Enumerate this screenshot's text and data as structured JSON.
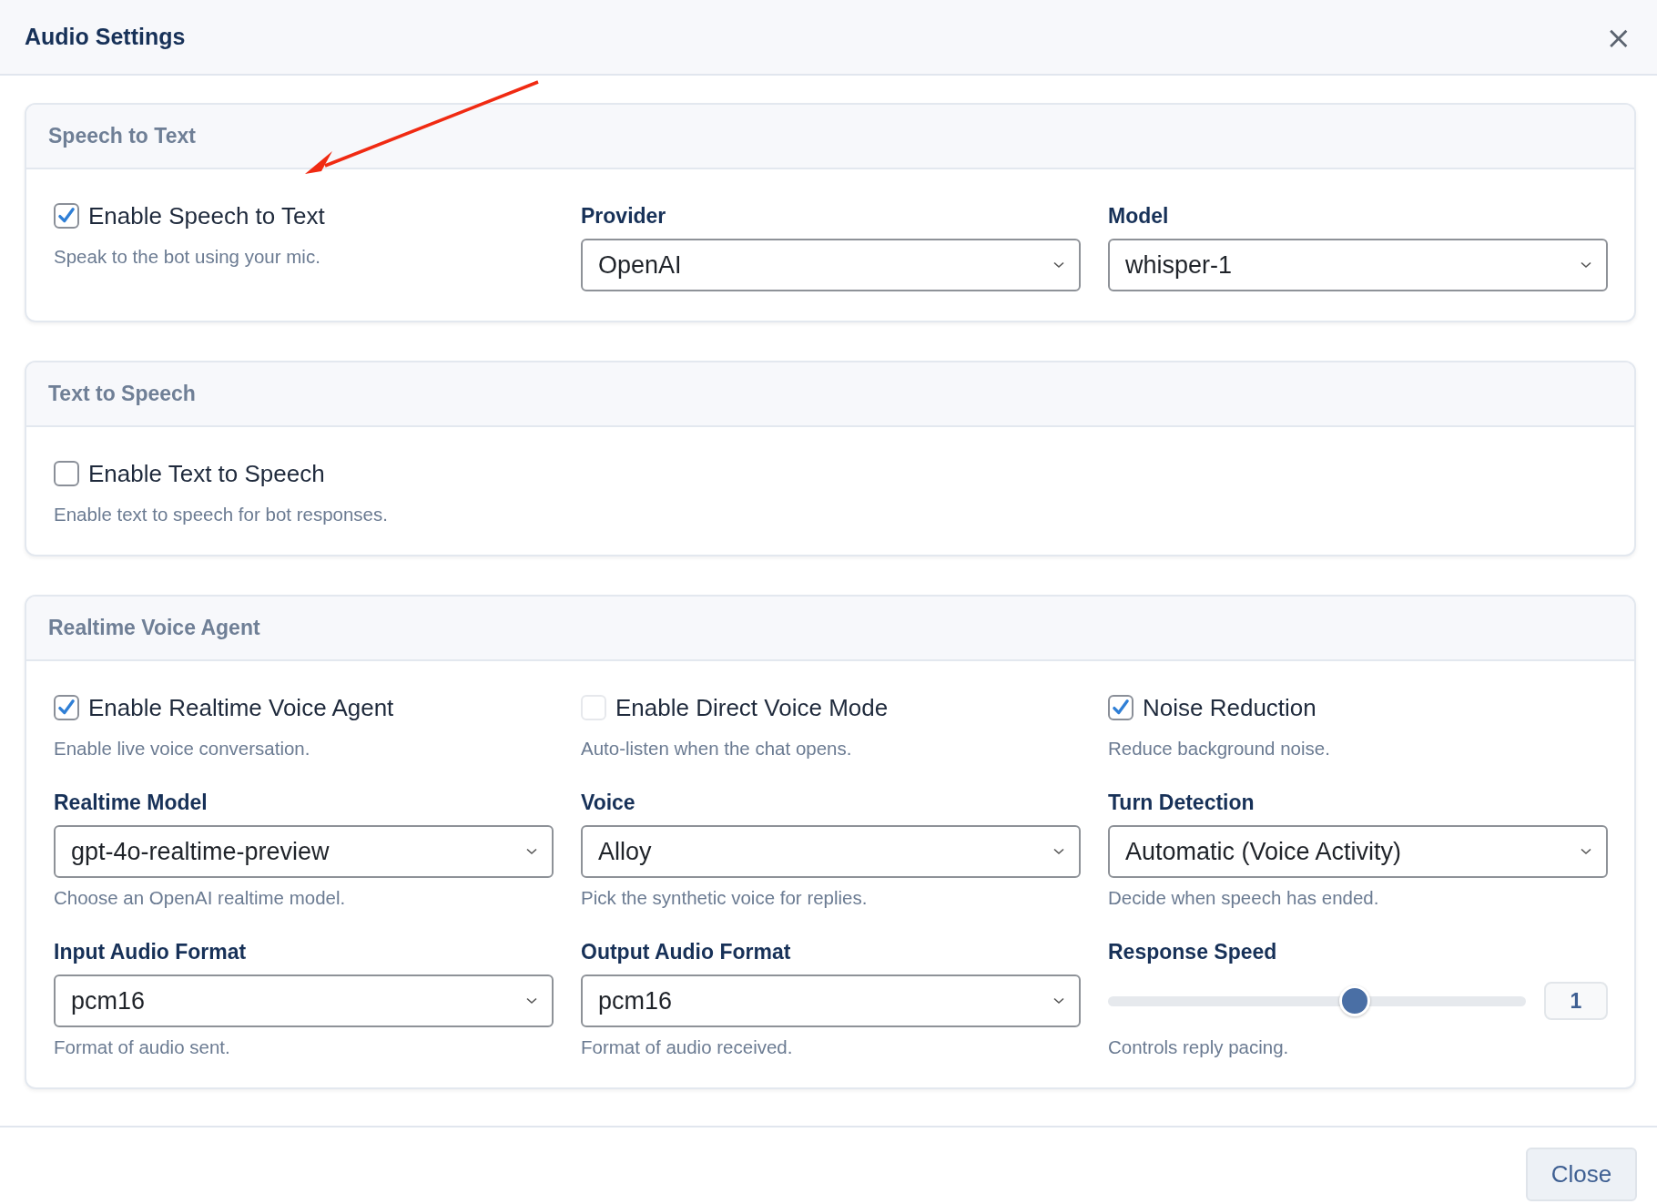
{
  "window": {
    "title": "Audio Settings",
    "close_icon": "×"
  },
  "annotation": {
    "kind": "arrow"
  },
  "sections": [
    {
      "title": "Speech to Text",
      "fields": [
        {
          "kind": "checkbox",
          "label": "Enable Speech to Text",
          "checked": true,
          "disabled": false,
          "help": "Speak to the bot using your mic."
        },
        {
          "kind": "select",
          "label": "Provider",
          "value": "OpenAI"
        },
        {
          "kind": "select",
          "label": "Model",
          "value": "whisper-1"
        }
      ]
    },
    {
      "title": "Text to Speech",
      "fields": [
        {
          "kind": "checkbox",
          "label": "Enable Text to Speech",
          "checked": false,
          "disabled": false,
          "help": "Enable text to speech for bot responses."
        }
      ]
    },
    {
      "title": "Realtime Voice Agent",
      "fields": [
        {
          "kind": "checkbox",
          "label": "Enable Realtime Voice Agent",
          "checked": true,
          "disabled": false,
          "help": "Enable live voice conversation."
        },
        {
          "kind": "checkbox",
          "label": "Enable Direct Voice Mode",
          "checked": false,
          "disabled": true,
          "help": "Auto-listen when the chat opens."
        },
        {
          "kind": "checkbox",
          "label": "Noise Reduction",
          "checked": true,
          "disabled": false,
          "help": "Reduce background noise."
        },
        {
          "kind": "select",
          "label": "Realtime Model",
          "value": "gpt-4o-realtime-preview",
          "help": "Choose an OpenAI realtime model."
        },
        {
          "kind": "select",
          "label": "Voice",
          "value": "Alloy",
          "help": "Pick the synthetic voice for replies."
        },
        {
          "kind": "select",
          "label": "Turn Detection",
          "value": "Automatic (Voice Activity)",
          "help": "Decide when speech has ended."
        },
        {
          "kind": "select",
          "label": "Input Audio Format",
          "value": "pcm16",
          "help": "Format of audio sent."
        },
        {
          "kind": "select",
          "label": "Output Audio Format",
          "value": "pcm16",
          "help": "Format of audio received."
        },
        {
          "kind": "slider",
          "label": "Response Speed",
          "level": 0.59,
          "reading": "1",
          "help": "Controls reply pacing."
        }
      ]
    }
  ],
  "footer": {
    "button": "Close"
  }
}
